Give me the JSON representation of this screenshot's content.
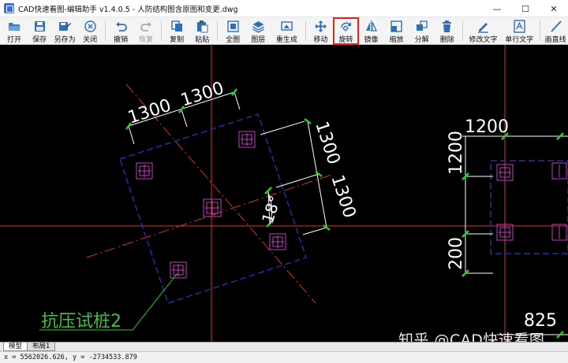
{
  "window": {
    "title": "CAD快速看图-编辑助手 v1.4.0.5 - 人防结构图含原图和变更.dwg",
    "controls": {
      "minimize": "—",
      "maximize": "☐",
      "close": "✕"
    }
  },
  "toolbar": {
    "items": [
      {
        "label": "打开",
        "icon": "open-folder-icon",
        "enabled": true
      },
      {
        "label": "保存",
        "icon": "save-disk-icon",
        "enabled": true
      },
      {
        "label": "另存为",
        "icon": "save-as-icon",
        "enabled": true
      },
      {
        "label": "关闭",
        "icon": "close-circle-icon",
        "enabled": true
      },
      {
        "label": "撤销",
        "icon": "undo-icon",
        "enabled": true
      },
      {
        "label": "恢复",
        "icon": "redo-icon",
        "enabled": false
      },
      {
        "label": "复制",
        "icon": "copy-icon",
        "enabled": true
      },
      {
        "label": "粘贴",
        "icon": "paste-icon",
        "enabled": true
      },
      {
        "label": "全图",
        "icon": "fit-all-icon",
        "enabled": true
      },
      {
        "label": "图层",
        "icon": "layers-icon",
        "enabled": true
      },
      {
        "label": "重生成",
        "icon": "regenerate-icon",
        "enabled": true
      },
      {
        "label": "移动",
        "icon": "move-icon",
        "enabled": true
      },
      {
        "label": "旋转",
        "icon": "rotate-icon",
        "enabled": true,
        "highlighted": true
      },
      {
        "label": "镜像",
        "icon": "mirror-icon",
        "enabled": true
      },
      {
        "label": "缩放",
        "icon": "scale-icon",
        "enabled": true
      },
      {
        "label": "分解",
        "icon": "explode-icon",
        "enabled": true
      },
      {
        "label": "删除",
        "icon": "delete-icon",
        "enabled": true
      },
      {
        "label": "修改文字",
        "icon": "edit-text-icon",
        "enabled": true
      },
      {
        "label": "单行文字",
        "icon": "single-line-text-icon",
        "enabled": true
      },
      {
        "label": "画直线",
        "icon": "draw-line-icon",
        "enabled": true
      }
    ],
    "highlight_color": "#e02424"
  },
  "drawing": {
    "dimensions": {
      "dim_top_1": "1300",
      "dim_top_2": "1300",
      "dim_right_1": "1300",
      "dim_right_2": "1300",
      "angle": "18°",
      "dim_right_block_top": "1200",
      "dim_right_block_left_1": "1200",
      "dim_right_block_left_2": "200",
      "dim_bottom_right": "825"
    },
    "pile_label": "抗压试桩2",
    "colors": {
      "background": "#000000",
      "axis_line": "#e03030",
      "dashed_outline": "#2a2aa8",
      "pile": "#c040c0",
      "dimension": "#ffffff",
      "dim_tick": "#20d020",
      "leader": "#20d020",
      "label_text": "#40c040"
    }
  },
  "watermark": "知乎 @CAD快速看图",
  "tabs": [
    {
      "label": "模型",
      "active": true
    },
    {
      "label": "布局1",
      "active": false
    }
  ],
  "status": {
    "coordinates": "x = 5562026.626, y = -2734533.879"
  }
}
